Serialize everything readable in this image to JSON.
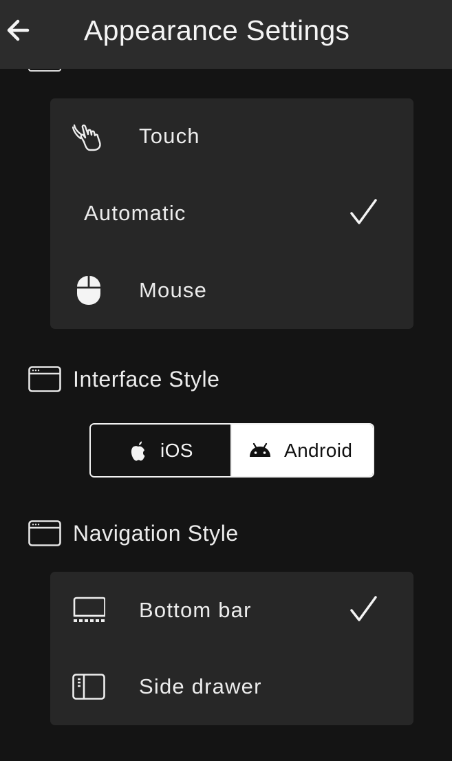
{
  "header": {
    "title": "Appearance Settings",
    "back_icon": "arrow-left-icon"
  },
  "input_mode": {
    "options": [
      {
        "label": "Touch",
        "icon": "touch-hand-icon",
        "selected": false
      },
      {
        "label": "Automatic",
        "icon": "",
        "selected": true
      },
      {
        "label": "Mouse",
        "icon": "mouse-icon",
        "selected": false
      }
    ]
  },
  "interface_style": {
    "title": "Interface Style",
    "icon": "window-icon",
    "options": [
      {
        "label": "iOS",
        "icon": "apple-icon",
        "selected": false
      },
      {
        "label": "Android",
        "icon": "android-icon",
        "selected": true
      }
    ]
  },
  "navigation_style": {
    "title": "Navigation Style",
    "icon": "window-icon",
    "options": [
      {
        "label": "Bottom bar",
        "icon": "bottom-bar-icon",
        "selected": true
      },
      {
        "label": "Side drawer",
        "icon": "side-drawer-icon",
        "selected": false
      }
    ]
  },
  "colors": {
    "background": "#141414",
    "app_bar": "#2c2c2c",
    "card": "#272727",
    "text": "#ececec",
    "segment_selected_bg": "#ffffff"
  }
}
